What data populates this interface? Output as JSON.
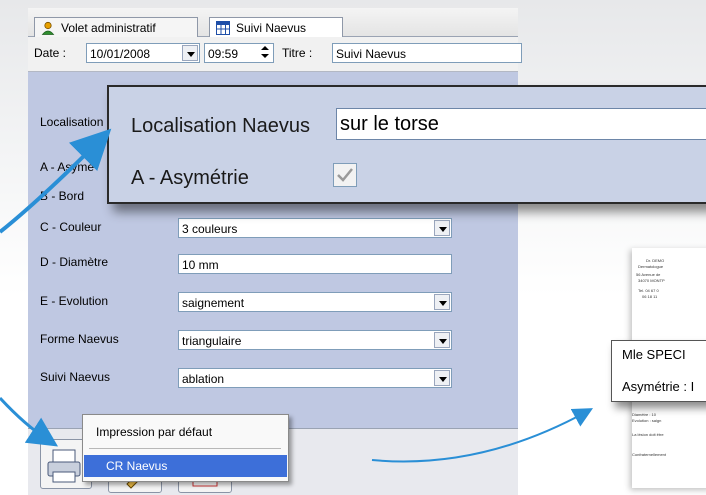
{
  "tabs": [
    {
      "label": "Volet administratif"
    },
    {
      "label": "Suivi Naevus"
    }
  ],
  "toolbar": {
    "date_label": "Date :",
    "date_value": "10/01/2008",
    "time_value": "09:59",
    "title_label": "Titre :",
    "title_value": "Suivi Naevus"
  },
  "form": {
    "localisation_label": "Localisation",
    "asym_label": "A - Asymé",
    "bord_label": "B - Bord",
    "couleur_label": "C - Couleur",
    "couleur_value": "3 couleurs",
    "diametre_label": "D - Diamètre",
    "diametre_value": "10 mm",
    "evolution_label": "E - Evolution",
    "evolution_value": "saignement",
    "forme_label": "Forme Naevus",
    "forme_value": "triangulaire",
    "suivi_label": "Suivi Naevus",
    "suivi_value": "ablation"
  },
  "zoom": {
    "localisation_label": "Localisation Naevus",
    "localisation_value": "sur le torse",
    "asym_label": "A - Asymétrie",
    "asym_checked": true
  },
  "menu": {
    "items": [
      "Impression par défaut",
      "CR Naevus"
    ],
    "selected": "CR Naevus",
    "selected_color": "#3d6fd9"
  },
  "preview": {
    "callout_line1": "Mle SPECI",
    "callout_line2": "Asymétrie : I"
  },
  "colors": {
    "arrow": "#2a8fd6",
    "panel": "#bfc8e2"
  }
}
